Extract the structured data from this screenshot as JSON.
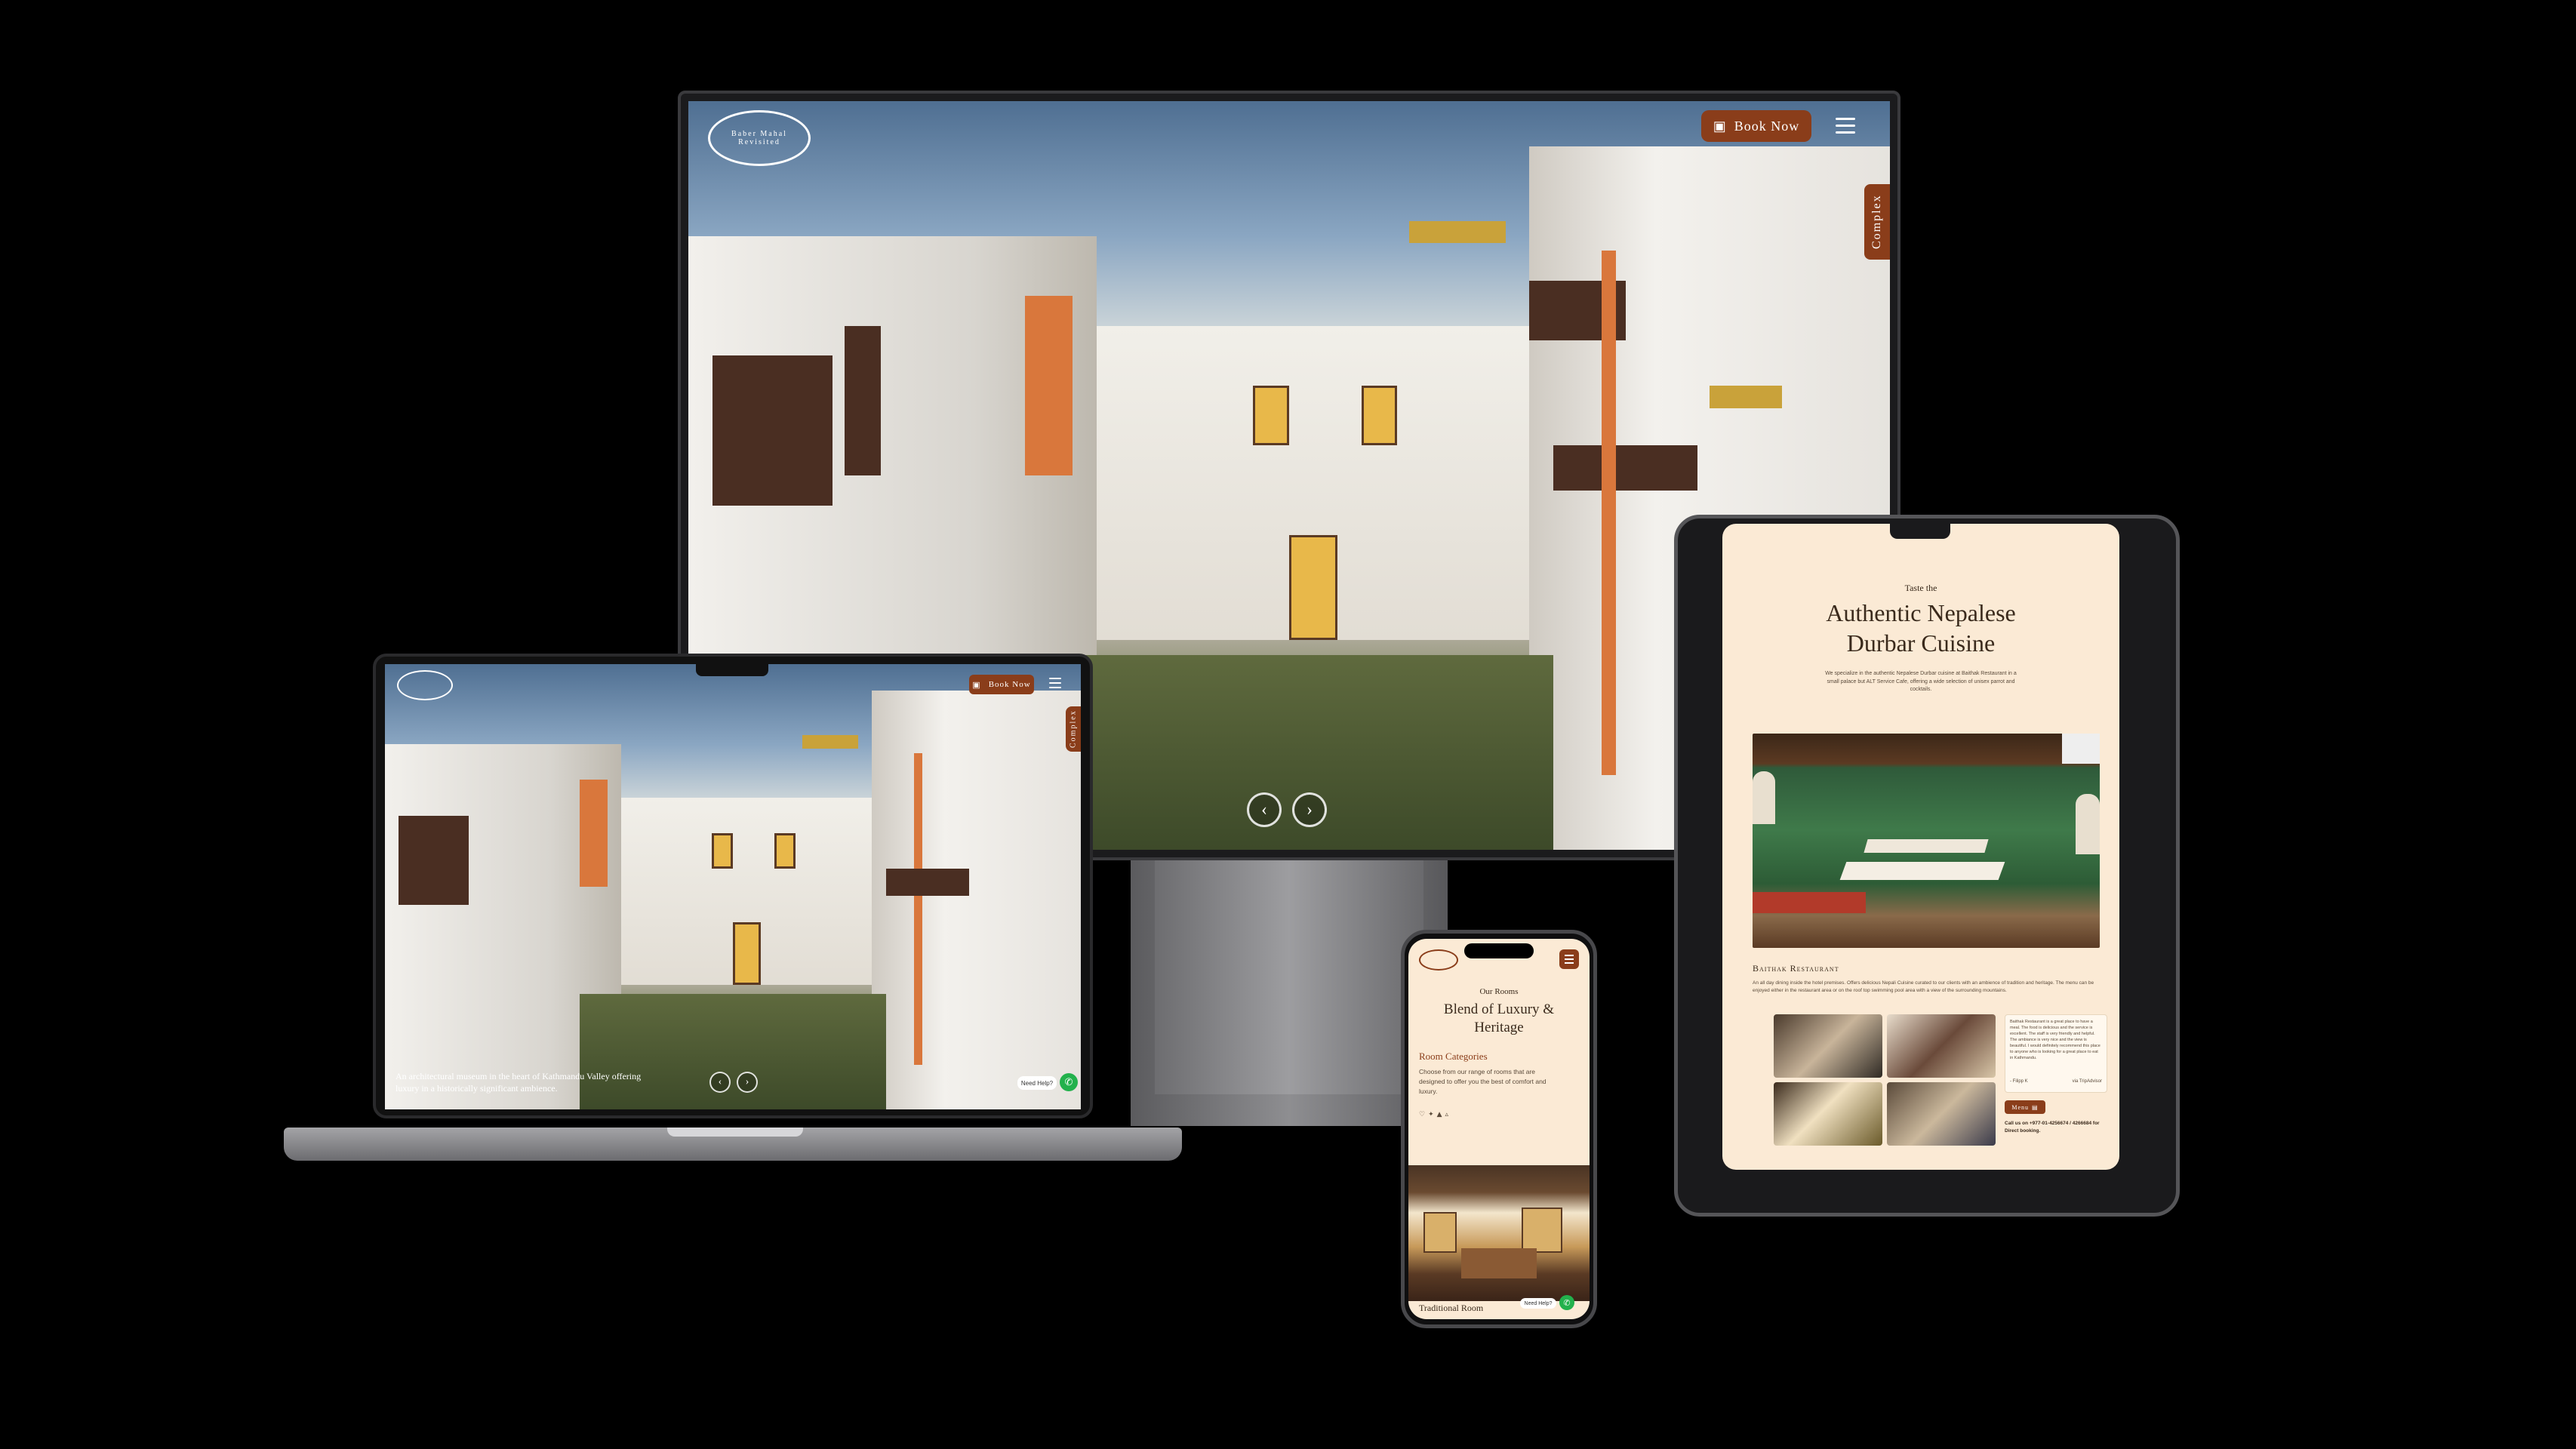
{
  "desktop": {
    "logo_text": "Baber Mahal Revisited",
    "book_label": "Book Now",
    "side_tab": "Complex",
    "nav_prev": "‹",
    "nav_next": "›"
  },
  "laptop": {
    "book_label": "Book Now",
    "side_tab": "Complex",
    "caption": "An architectural museum in the heart of Kathmandu Valley offering luxury in a historically significant ambience.",
    "help": "Need Help?",
    "nav_prev": "‹",
    "nav_next": "›"
  },
  "tablet": {
    "eyebrow": "Taste the",
    "title_line1": "Authentic Nepalese",
    "title_line2": "Durbar Cuisine",
    "intro": "We specialize in the authentic Nepalese Durbar cuisine at Baithak Restaurant in a small palace but ALT Service Cafe, offering a wide selection of unisex parrot and cocktails.",
    "section_title": "Baithak Restaurant",
    "section_text": "An all day dining inside the hotel premises. Offers delicious Nepali Cuisine curated to our clients with an ambience of tradition and heritage. The menu can be enjoyed either in the restaurant area or on the roof top swimming pool area with a view of the surrounding mountains.",
    "review_text": "Baithak Restaurant is a great place to have a meal. The food is delicious and the service is excellent. The staff is very friendly and helpful. The ambiance is very nice and the view is beautiful. I would definitely recommend this place to anyone who is looking for a great place to eat in Kathmandu.",
    "review_author": "- Filipp K",
    "review_source": "via TripAdvisor",
    "menu_button": "Menu",
    "call_text": "Call us on +977-01-4256674 / 4266684 for Direct booking."
  },
  "phone": {
    "eyebrow": "Our Rooms",
    "title": "Blend of Luxury & Heritage",
    "categories_heading": "Room Categories",
    "categories_text": "Choose from our range of rooms that are designed to offer you the best of comfort and luxury.",
    "room_name": "Traditional Room",
    "help": "Need Help?"
  },
  "colors": {
    "brand": "#8a3d1a",
    "cream": "#fbead5",
    "whatsapp": "#22b14c"
  },
  "icons": [
    "calendar-icon",
    "menu-icon",
    "chevron-left-icon",
    "chevron-right-icon",
    "whatsapp-icon",
    "menu-book-icon"
  ]
}
